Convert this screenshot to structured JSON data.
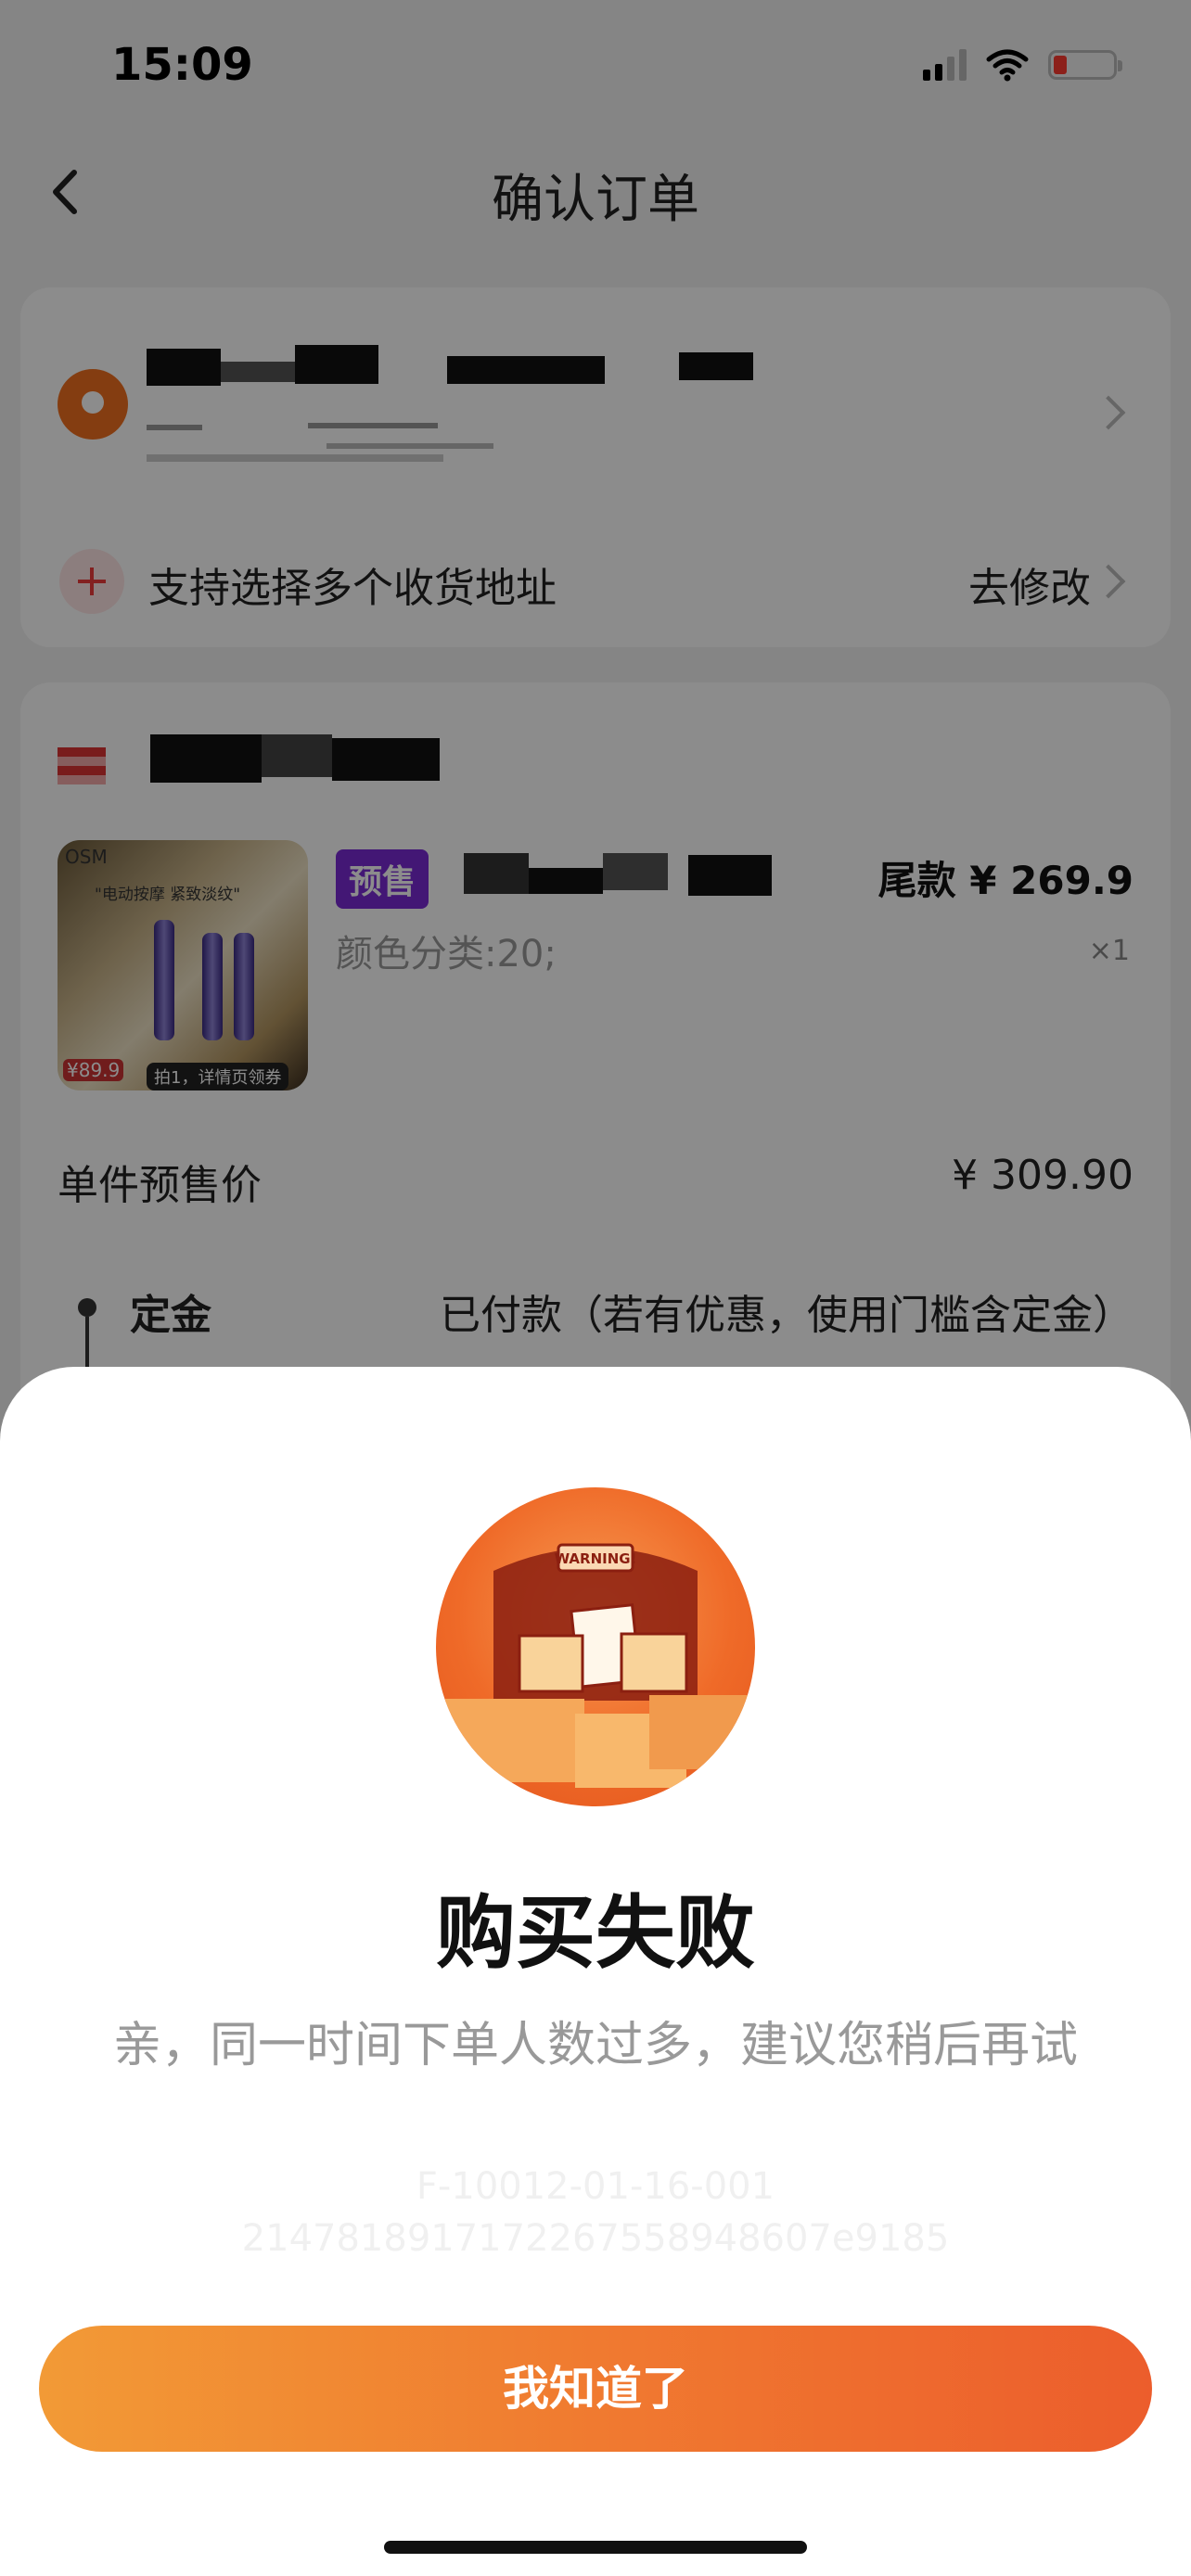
{
  "status_bar": {
    "time": "15:09"
  },
  "header": {
    "title": "确认订单",
    "back_icon": "chevron-left-icon"
  },
  "address": {
    "add_multiple_label": "支持选择多个收货地址",
    "edit_label": "去修改"
  },
  "order": {
    "presale_tag": "预售",
    "balance_label": "尾款",
    "balance_price": "¥ 269.9",
    "variant": "颜色分类:20;",
    "quantity": "×1",
    "unit_price_label": "单件预售价",
    "unit_price": "¥ 309.90",
    "deposit_label": "定金",
    "deposit_status": "已付款（若有优惠，使用门槛含定金）",
    "product_image_text": {
      "brand": "OSM",
      "slogan": "\"电动按摩  紧致淡纹\"",
      "price_badge": "¥89.9",
      "promo": "拍1，详情页领券"
    }
  },
  "dialog": {
    "illustration_text": "WARNING!",
    "title": "购买失败",
    "message": "亲，同一时间下单人数过多，建议您稍后再试",
    "error_code": "F-10012-01-16-001",
    "trace_id": "2147818917172267558948607e9185",
    "confirm_label": "我知道了"
  },
  "colors": {
    "accent_orange": "#f07a30",
    "presale_purple": "#7a2bd6",
    "pin_orange": "#f0701f"
  }
}
